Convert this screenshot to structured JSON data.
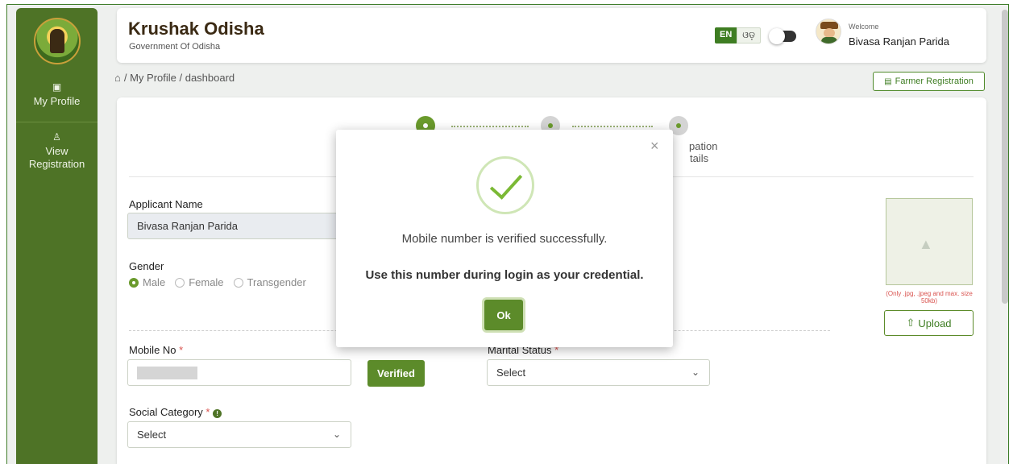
{
  "app": {
    "title": "Krushak Odisha",
    "subtitle": "Government Of Odisha"
  },
  "header": {
    "lang_en": "EN",
    "lang_od": "ଓଡ଼",
    "welcome": "Welcome",
    "user_name": "Bivasa Ranjan Parida"
  },
  "sidebar": {
    "items": [
      {
        "label": "My Profile",
        "icon": "id-card-icon"
      },
      {
        "label": "View Registration",
        "icon": "user-icon"
      }
    ]
  },
  "breadcrumb": {
    "text": "/ My Profile / dashboard"
  },
  "actions": {
    "farmer_registration": "Farmer Registration"
  },
  "stepper": {
    "partial_label_line1": "pation",
    "partial_label_line2": "tails"
  },
  "form": {
    "applicant_name_label": "Applicant Name",
    "applicant_name_value": "Bivasa Ranjan Parida",
    "gender_label": "Gender",
    "gender_options": [
      "Male",
      "Female",
      "Transgender"
    ],
    "gender_selected": "Male",
    "mobile_label": "Mobile No",
    "verified_label": "Verified",
    "marital_label": "Marital Status",
    "marital_value": "Select",
    "social_label": "Social Category",
    "social_value": "Select",
    "required_mark": "*"
  },
  "photo": {
    "note": "(Only .jpg, .jpeg and max. size 50kb)",
    "upload_label": "Upload"
  },
  "modal": {
    "message": "Mobile number is verified successfully.",
    "message_bold": "Use this number during login as your credential.",
    "ok_label": "Ok",
    "close_glyph": "×"
  },
  "colors": {
    "sidebar_green": "#4e7326",
    "button_green": "#5c8b2a",
    "required_red": "#d9534f",
    "brand_brown": "#3b2a14"
  }
}
